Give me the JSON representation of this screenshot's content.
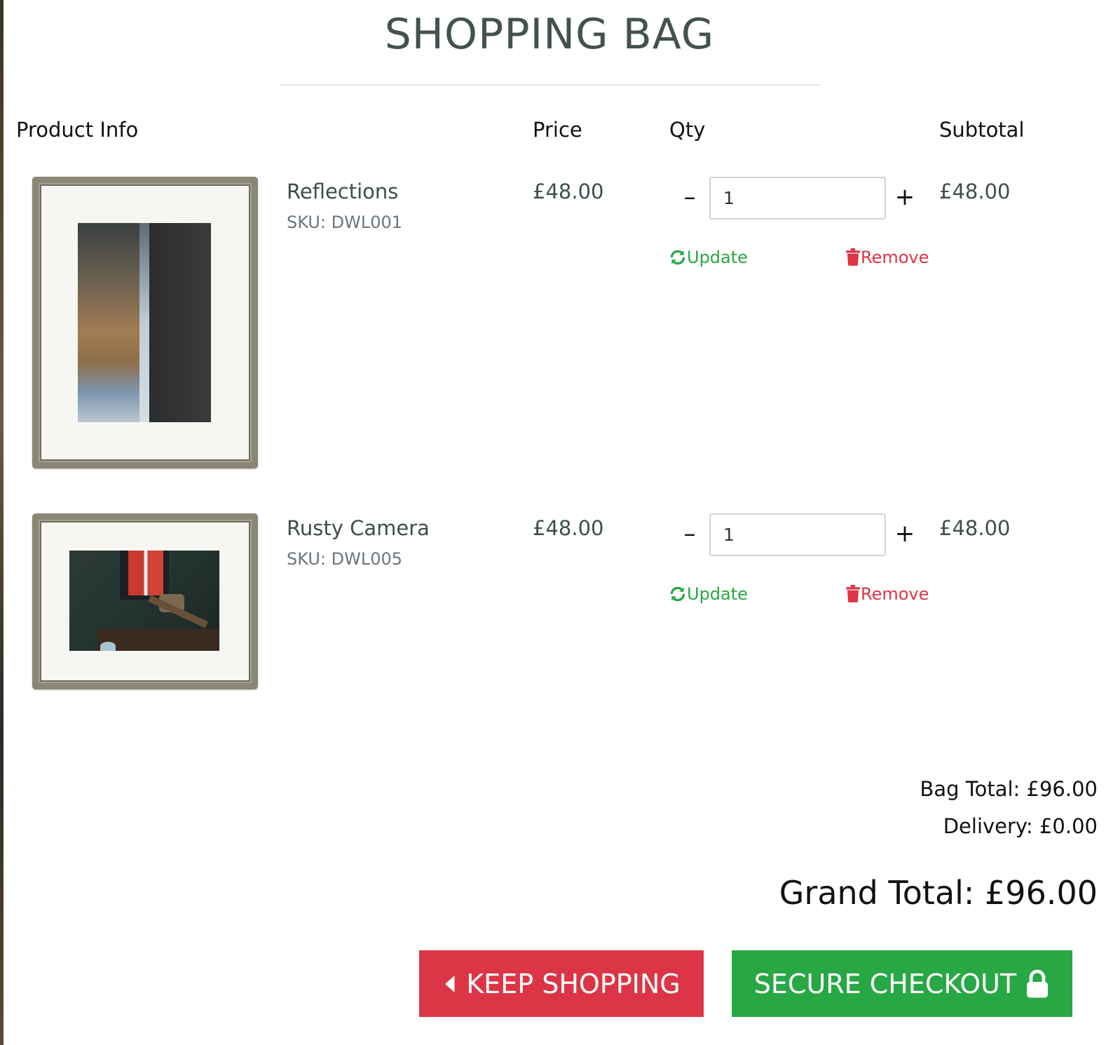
{
  "page": {
    "title": "SHOPPING BAG"
  },
  "columns": {
    "product_info": "Product Info",
    "price": "Price",
    "qty": "Qty",
    "subtotal": "Subtotal"
  },
  "items": [
    {
      "name": "Reflections",
      "sku": "SKU: DWL001",
      "price": "£48.00",
      "qty": "1",
      "subtotal": "£48.00",
      "decrement_symbol": "–",
      "increment_symbol": "+",
      "update_label": "Update",
      "remove_label": "Remove"
    },
    {
      "name": "Rusty Camera",
      "sku": "SKU: DWL005",
      "price": "£48.00",
      "qty": "1",
      "subtotal": "£48.00",
      "decrement_symbol": "–",
      "increment_symbol": "+",
      "update_label": "Update",
      "remove_label": "Remove"
    }
  ],
  "totals": {
    "bag_total": "Bag Total: £96.00",
    "delivery": "Delivery: £0.00",
    "grand_total": "Grand Total: £96.00"
  },
  "buttons": {
    "keep_shopping": "KEEP SHOPPING",
    "secure_checkout": "SECURE CHECKOUT"
  },
  "icons": {
    "update": "refresh-icon",
    "remove": "trash-icon",
    "keep_shopping": "caret-left-icon",
    "checkout": "lock-icon"
  },
  "colors": {
    "success": "#28a745",
    "danger": "#dc3545",
    "heading": "#435150"
  }
}
